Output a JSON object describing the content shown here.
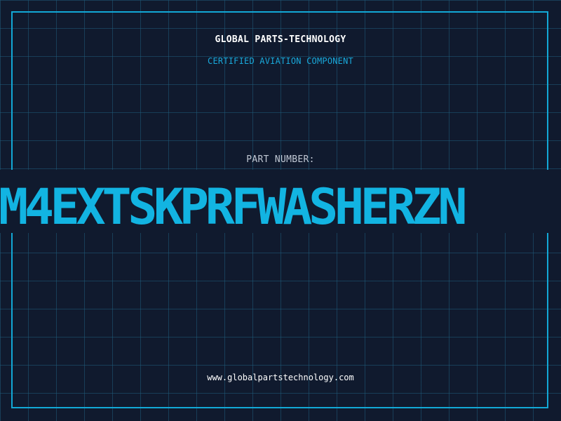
{
  "header": {
    "company": "GLOBAL PARTS-TECHNOLOGY",
    "subtitle": "CERTIFIED AVIATION COMPONENT"
  },
  "part": {
    "label": "PART NUMBER:",
    "number": "M4EXTSKPRFWASHERZN"
  },
  "footer": {
    "url": "www.globalpartstechnology.com"
  },
  "colors": {
    "background": "#101a2e",
    "grid": "#1f5a7a",
    "accent": "#12b4e2",
    "frame": "#12a8d6",
    "text": "#ffffff",
    "muted": "#c0c8d4"
  }
}
